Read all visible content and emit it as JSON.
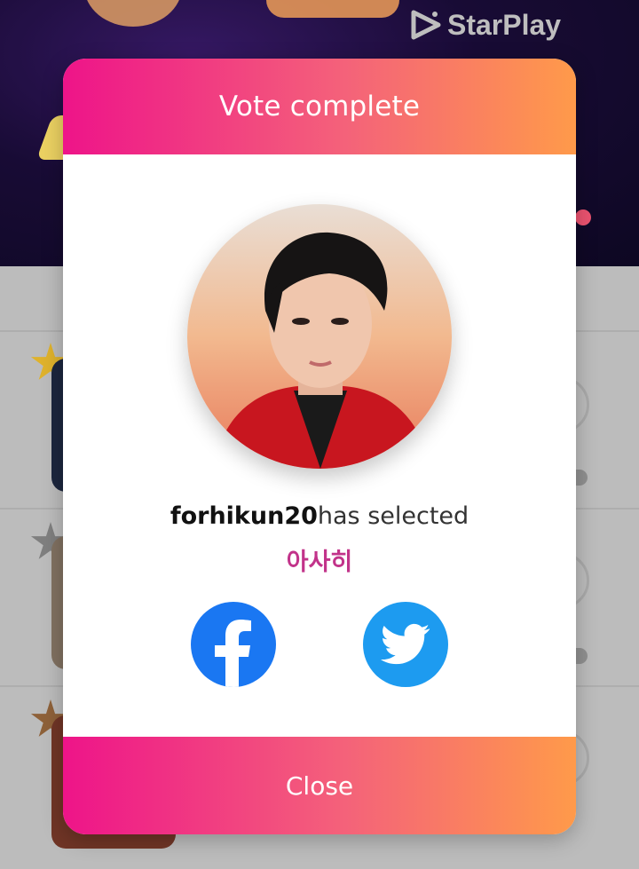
{
  "background": {
    "brand_logo_text": "StarPlay",
    "rank_badges": [
      "1",
      "2",
      "3"
    ]
  },
  "modal": {
    "title": "Vote complete",
    "username": "forhikun20",
    "selected_text": "has selected",
    "candidate_name": "아사히",
    "share_buttons": [
      {
        "name": "facebook",
        "icon": "facebook-icon",
        "color": "#1a77f2"
      },
      {
        "name": "twitter",
        "icon": "twitter-icon",
        "color": "#1d9bf0"
      }
    ],
    "close_label": "Close",
    "accent_gradient": [
      "#ee1489",
      "#ff9a4a"
    ],
    "candidate_color": "#c2338a"
  }
}
